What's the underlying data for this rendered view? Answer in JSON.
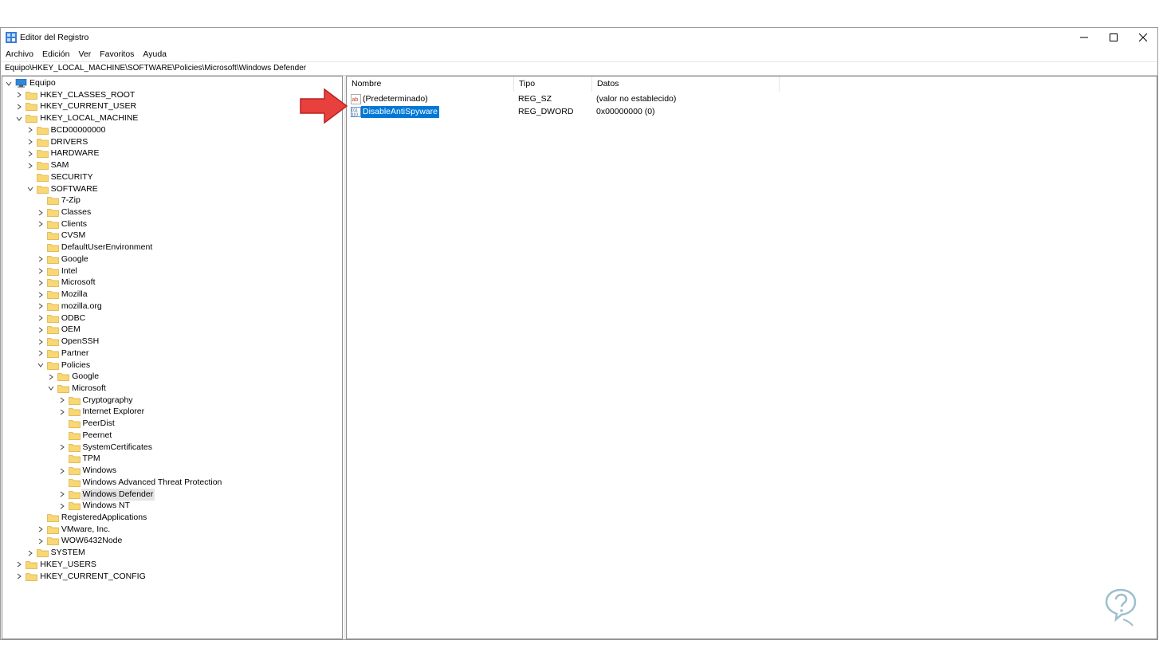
{
  "window": {
    "title": "Editor del Registro",
    "controls": {
      "minimize": "minimize",
      "maximize": "maximize",
      "close": "close"
    }
  },
  "menu": [
    "Archivo",
    "Edición",
    "Ver",
    "Favoritos",
    "Ayuda"
  ],
  "address": "Equipo\\HKEY_LOCAL_MACHINE\\SOFTWARE\\Policies\\Microsoft\\Windows Defender",
  "tree": [
    {
      "label": "Equipo",
      "depth": 0,
      "state": "expanded",
      "icon": "computer-icon"
    },
    {
      "label": "HKEY_CLASSES_ROOT",
      "depth": 1,
      "state": "collapsed"
    },
    {
      "label": "HKEY_CURRENT_USER",
      "depth": 1,
      "state": "collapsed"
    },
    {
      "label": "HKEY_LOCAL_MACHINE",
      "depth": 1,
      "state": "expanded"
    },
    {
      "label": "BCD00000000",
      "depth": 2,
      "state": "collapsed"
    },
    {
      "label": "DRIVERS",
      "depth": 2,
      "state": "collapsed"
    },
    {
      "label": "HARDWARE",
      "depth": 2,
      "state": "collapsed"
    },
    {
      "label": "SAM",
      "depth": 2,
      "state": "collapsed"
    },
    {
      "label": "SECURITY",
      "depth": 2,
      "state": "leaf"
    },
    {
      "label": "SOFTWARE",
      "depth": 2,
      "state": "expanded"
    },
    {
      "label": "7-Zip",
      "depth": 3,
      "state": "leaf"
    },
    {
      "label": "Classes",
      "depth": 3,
      "state": "collapsed"
    },
    {
      "label": "Clients",
      "depth": 3,
      "state": "collapsed"
    },
    {
      "label": "CVSM",
      "depth": 3,
      "state": "leaf"
    },
    {
      "label": "DefaultUserEnvironment",
      "depth": 3,
      "state": "leaf"
    },
    {
      "label": "Google",
      "depth": 3,
      "state": "collapsed"
    },
    {
      "label": "Intel",
      "depth": 3,
      "state": "collapsed"
    },
    {
      "label": "Microsoft",
      "depth": 3,
      "state": "collapsed"
    },
    {
      "label": "Mozilla",
      "depth": 3,
      "state": "collapsed"
    },
    {
      "label": "mozilla.org",
      "depth": 3,
      "state": "collapsed"
    },
    {
      "label": "ODBC",
      "depth": 3,
      "state": "collapsed"
    },
    {
      "label": "OEM",
      "depth": 3,
      "state": "collapsed"
    },
    {
      "label": "OpenSSH",
      "depth": 3,
      "state": "collapsed"
    },
    {
      "label": "Partner",
      "depth": 3,
      "state": "collapsed"
    },
    {
      "label": "Policies",
      "depth": 3,
      "state": "expanded"
    },
    {
      "label": "Google",
      "depth": 4,
      "state": "collapsed"
    },
    {
      "label": "Microsoft",
      "depth": 4,
      "state": "expanded"
    },
    {
      "label": "Cryptography",
      "depth": 5,
      "state": "collapsed"
    },
    {
      "label": "Internet Explorer",
      "depth": 5,
      "state": "collapsed"
    },
    {
      "label": "PeerDist",
      "depth": 5,
      "state": "leaf"
    },
    {
      "label": "Peernet",
      "depth": 5,
      "state": "leaf"
    },
    {
      "label": "SystemCertificates",
      "depth": 5,
      "state": "collapsed"
    },
    {
      "label": "TPM",
      "depth": 5,
      "state": "leaf"
    },
    {
      "label": "Windows",
      "depth": 5,
      "state": "collapsed"
    },
    {
      "label": "Windows Advanced Threat Protection",
      "depth": 5,
      "state": "leaf"
    },
    {
      "label": "Windows Defender",
      "depth": 5,
      "state": "collapsed",
      "selected": true
    },
    {
      "label": "Windows NT",
      "depth": 5,
      "state": "collapsed"
    },
    {
      "label": "RegisteredApplications",
      "depth": 3,
      "state": "leaf"
    },
    {
      "label": "VMware, Inc.",
      "depth": 3,
      "state": "collapsed"
    },
    {
      "label": "WOW6432Node",
      "depth": 3,
      "state": "collapsed"
    },
    {
      "label": "SYSTEM",
      "depth": 2,
      "state": "collapsed"
    },
    {
      "label": "HKEY_USERS",
      "depth": 1,
      "state": "collapsed"
    },
    {
      "label": "HKEY_CURRENT_CONFIG",
      "depth": 1,
      "state": "collapsed"
    }
  ],
  "columns": {
    "name": "Nombre",
    "type": "Tipo",
    "data": "Datos"
  },
  "values": [
    {
      "name": "(Predeterminado)",
      "type": "REG_SZ",
      "data": "(valor no establecido)",
      "icon": "string-value-icon",
      "selected": false
    },
    {
      "name": "DisableAntiSpyware",
      "type": "REG_DWORD",
      "data": "0x00000000 (0)",
      "icon": "binary-value-icon",
      "selected": true
    }
  ],
  "colors": {
    "selection": "#0078d7",
    "folder": "#f8d775",
    "arrow": "#e8403d"
  }
}
